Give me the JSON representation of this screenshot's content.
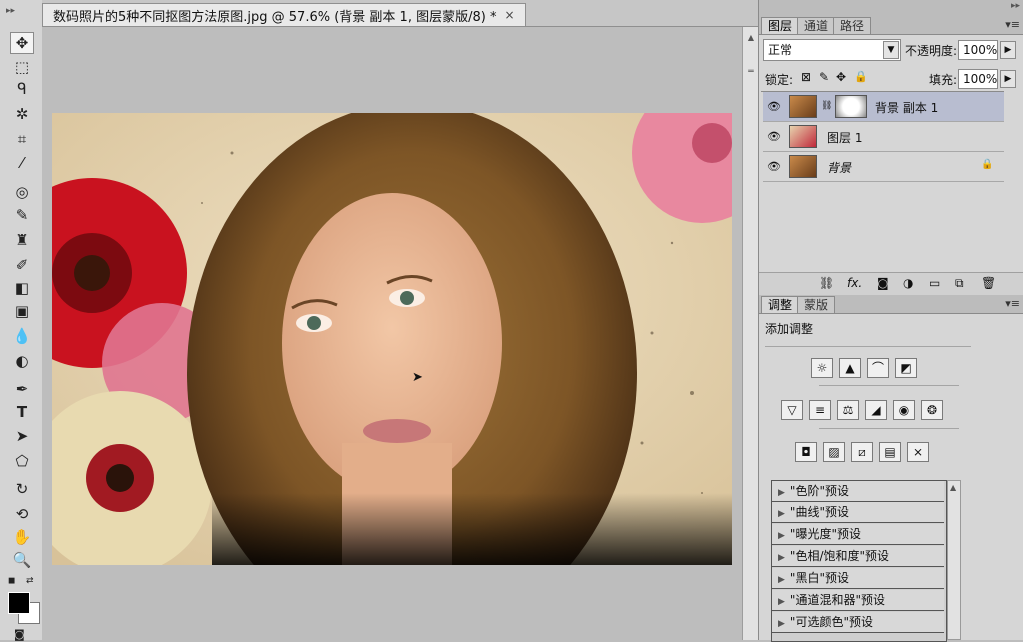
{
  "document": {
    "tab_title": "数码照片的5种不同抠图方法原图.jpg @ 57.6% (背景 副本 1, 图层蒙版/8) *",
    "close_glyph": "×"
  },
  "toolbar": {
    "tools": [
      "move-tool",
      "marquee-tool",
      "lasso-tool",
      "magic-wand-tool",
      "crop-tool",
      "eyedropper-tool",
      "spot-healing-tool",
      "brush-tool",
      "clone-stamp-tool",
      "history-brush-tool",
      "eraser-tool",
      "gradient-tool",
      "blur-tool",
      "dodge-tool",
      "pen-tool",
      "type-tool",
      "path-selection-tool",
      "shape-tool",
      "3d-rotate-tool",
      "3d-orbit-tool",
      "hand-tool",
      "zoom-tool"
    ],
    "type_tool_label": "T"
  },
  "layers_panel": {
    "tabs": [
      "图层",
      "通道",
      "路径"
    ],
    "blend_mode": "正常",
    "opacity_label": "不透明度:",
    "opacity_value": "100%",
    "lock_label": "锁定:",
    "fill_label": "填充:",
    "fill_value": "100%",
    "layers": [
      {
        "name": "背景 副本 1",
        "selected": true
      },
      {
        "name": "图层 1",
        "selected": false
      },
      {
        "name": "背景",
        "selected": false
      }
    ],
    "footer_fx": "fx."
  },
  "adjustments_panel": {
    "tabs": [
      "调整",
      "蒙版"
    ],
    "heading": "添加调整",
    "presets": [
      "\"色阶\"预设",
      "\"曲线\"预设",
      "\"曝光度\"预设",
      "\"色相/饱和度\"预设",
      "\"黑白\"预设",
      "\"通道混和器\"预设",
      "\"可选颜色\"预设"
    ]
  },
  "colors": {
    "selected_layer": "#b8bdd0",
    "panel_bg": "#d6d6d6",
    "canvas_bg": "#bdbdbd"
  }
}
